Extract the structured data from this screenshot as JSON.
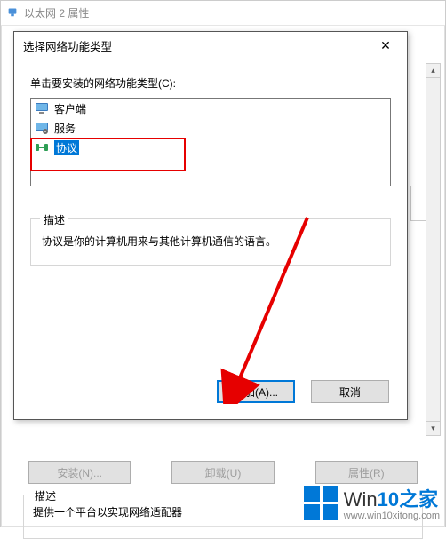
{
  "parent": {
    "title": "以太网 2 属性",
    "buttons": {
      "install": "安装(N)...",
      "uninstall": "卸载(U)",
      "properties": "属性(R)"
    },
    "desc_legend": "描述",
    "desc_text": "提供一个平台以实现网络适配器"
  },
  "dialog": {
    "title": "选择网络功能类型",
    "close": "✕",
    "subtitle": "单击要安装的网络功能类型(C):",
    "items": [
      {
        "label": "客户端"
      },
      {
        "label": "服务"
      },
      {
        "label": "协议",
        "selected": true
      }
    ],
    "desc_legend": "描述",
    "desc_text": "协议是你的计算机用来与其他计算机通信的语言。",
    "add": "添加(A)...",
    "cancel": "取消"
  },
  "watermark": {
    "brandA": "Win",
    "brandB": "10",
    "brandC": "之家",
    "url": "www.win10xitong.com"
  }
}
